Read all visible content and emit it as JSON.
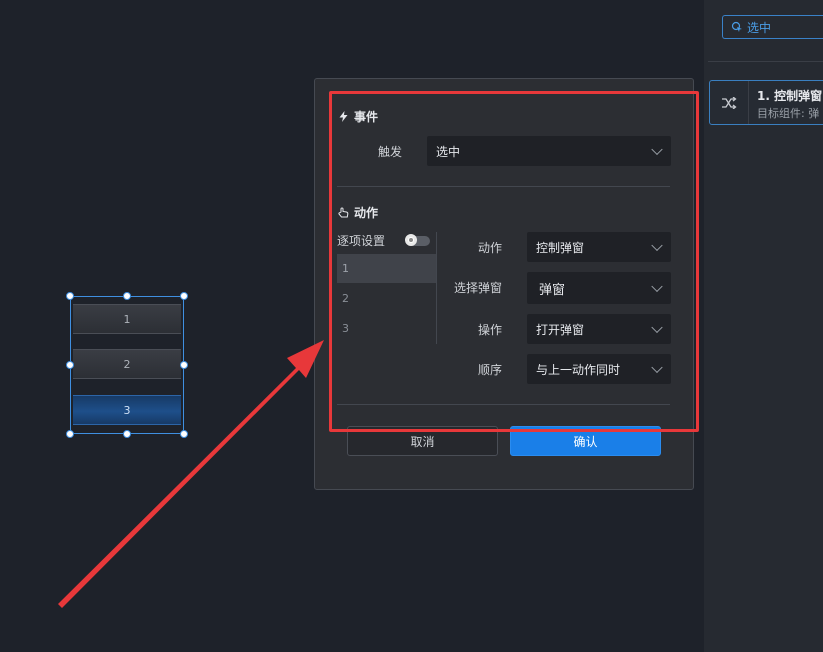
{
  "right_panel": {
    "select_chip_label": "选中",
    "action_card": {
      "title": "1. 控制弹窗",
      "subtitle": "目标组件: 弹"
    }
  },
  "widget": {
    "rows": [
      "1",
      "2",
      "3"
    ],
    "active_row": "3"
  },
  "dialog": {
    "event_section": {
      "title": "事件",
      "trigger_label": "触发",
      "trigger_value": "选中"
    },
    "action_section": {
      "title": "动作",
      "per_item_label": "逐项设置",
      "items": [
        "1",
        "2",
        "3"
      ],
      "fields": {
        "action_label": "动作",
        "action_value": "控制弹窗",
        "select_popup_label": "选择弹窗",
        "select_popup_value": "弹窗",
        "operation_label": "操作",
        "operation_value": "打开弹窗",
        "order_label": "顺序",
        "order_value": "与上一动作同时"
      }
    },
    "buttons": {
      "cancel": "取消",
      "confirm": "确认"
    }
  },
  "colors": {
    "accent": "#1a7fe8",
    "highlight_box": "#e8383a",
    "arrow": "#e8383a"
  }
}
